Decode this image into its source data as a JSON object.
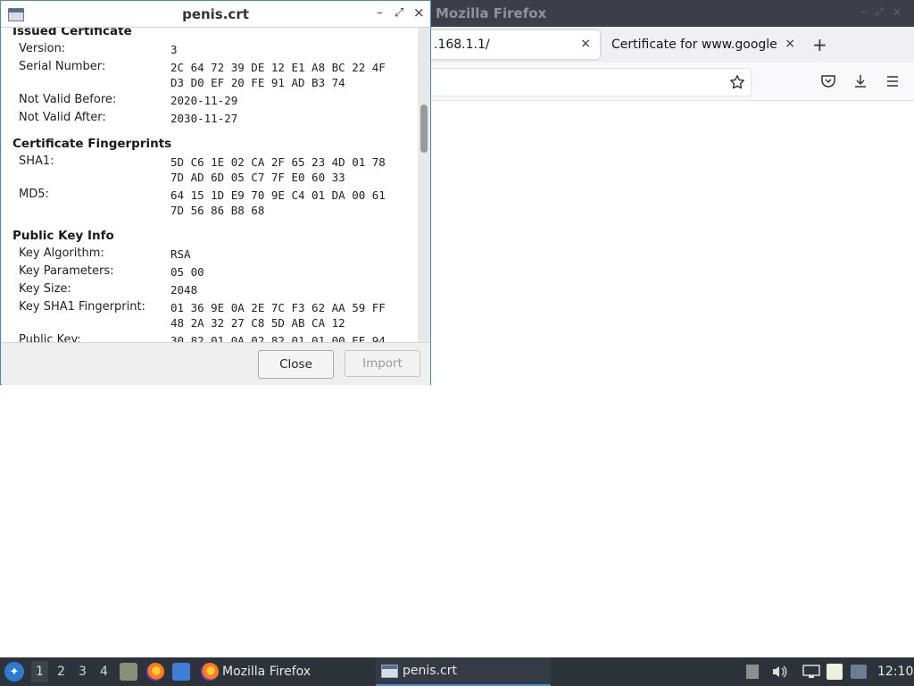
{
  "firefox": {
    "window_title": "Mozilla Firefox",
    "tabs": [
      {
        "label": ".168.1.1/",
        "close": "×",
        "active": true
      },
      {
        "label": "Certificate for www.google.c",
        "close": "×",
        "active": false
      }
    ],
    "new_tab": "+",
    "window_buttons": [
      "–",
      "⤢",
      "×"
    ]
  },
  "dialog": {
    "title": "penis.crt",
    "title_buttons": {
      "minimize": "–",
      "maximize": "⤢",
      "close": "×"
    },
    "sections": {
      "issued": {
        "heading": "Issued Certificate",
        "rows": [
          {
            "label": "Version:",
            "value": "3"
          },
          {
            "label": "Serial Number:",
            "value": "2C 64 72 39 DE 12 E1 A8 BC 22 4F\nD3 D0 EF 20 FE 91 AD B3 74"
          },
          {
            "label": "Not Valid Before:",
            "value": "2020-11-29"
          },
          {
            "label": "Not Valid After:",
            "value": "2030-11-27"
          }
        ]
      },
      "fingerprints": {
        "heading": "Certificate Fingerprints",
        "rows": [
          {
            "label": "SHA1:",
            "value": "5D C6 1E 02 CA 2F 65 23 4D 01 78\n7D AD 6D 05 C7 7F E0 60 33"
          },
          {
            "label": "MD5:",
            "value": "64 15 1D E9 70 9E C4 01 DA 00 61\n7D 56 86 B8 68"
          }
        ]
      },
      "pubkey": {
        "heading": "Public Key Info",
        "rows": [
          {
            "label": "Key Algorithm:",
            "value": "RSA"
          },
          {
            "label": "Key Parameters:",
            "value": "05 00"
          },
          {
            "label": "Key Size:",
            "value": "2048"
          },
          {
            "label": "Key SHA1 Fingerprint:",
            "value": "01 36 9E 0A 2E 7C F3 62 AA 59 FF\n48 2A 32 27 C8 5D AB CA 12"
          },
          {
            "label": "Public Key:",
            "value": "30 82 01 0A 02 82 01 01 00 EE 94"
          }
        ]
      }
    },
    "buttons": {
      "close": "Close",
      "import": "Import"
    }
  },
  "taskbar": {
    "workspaces": [
      "1",
      "2",
      "3",
      "4"
    ],
    "tasks": [
      {
        "label": "Mozilla Firefox"
      },
      {
        "label": "penis.crt"
      }
    ],
    "clock": "12:10"
  }
}
